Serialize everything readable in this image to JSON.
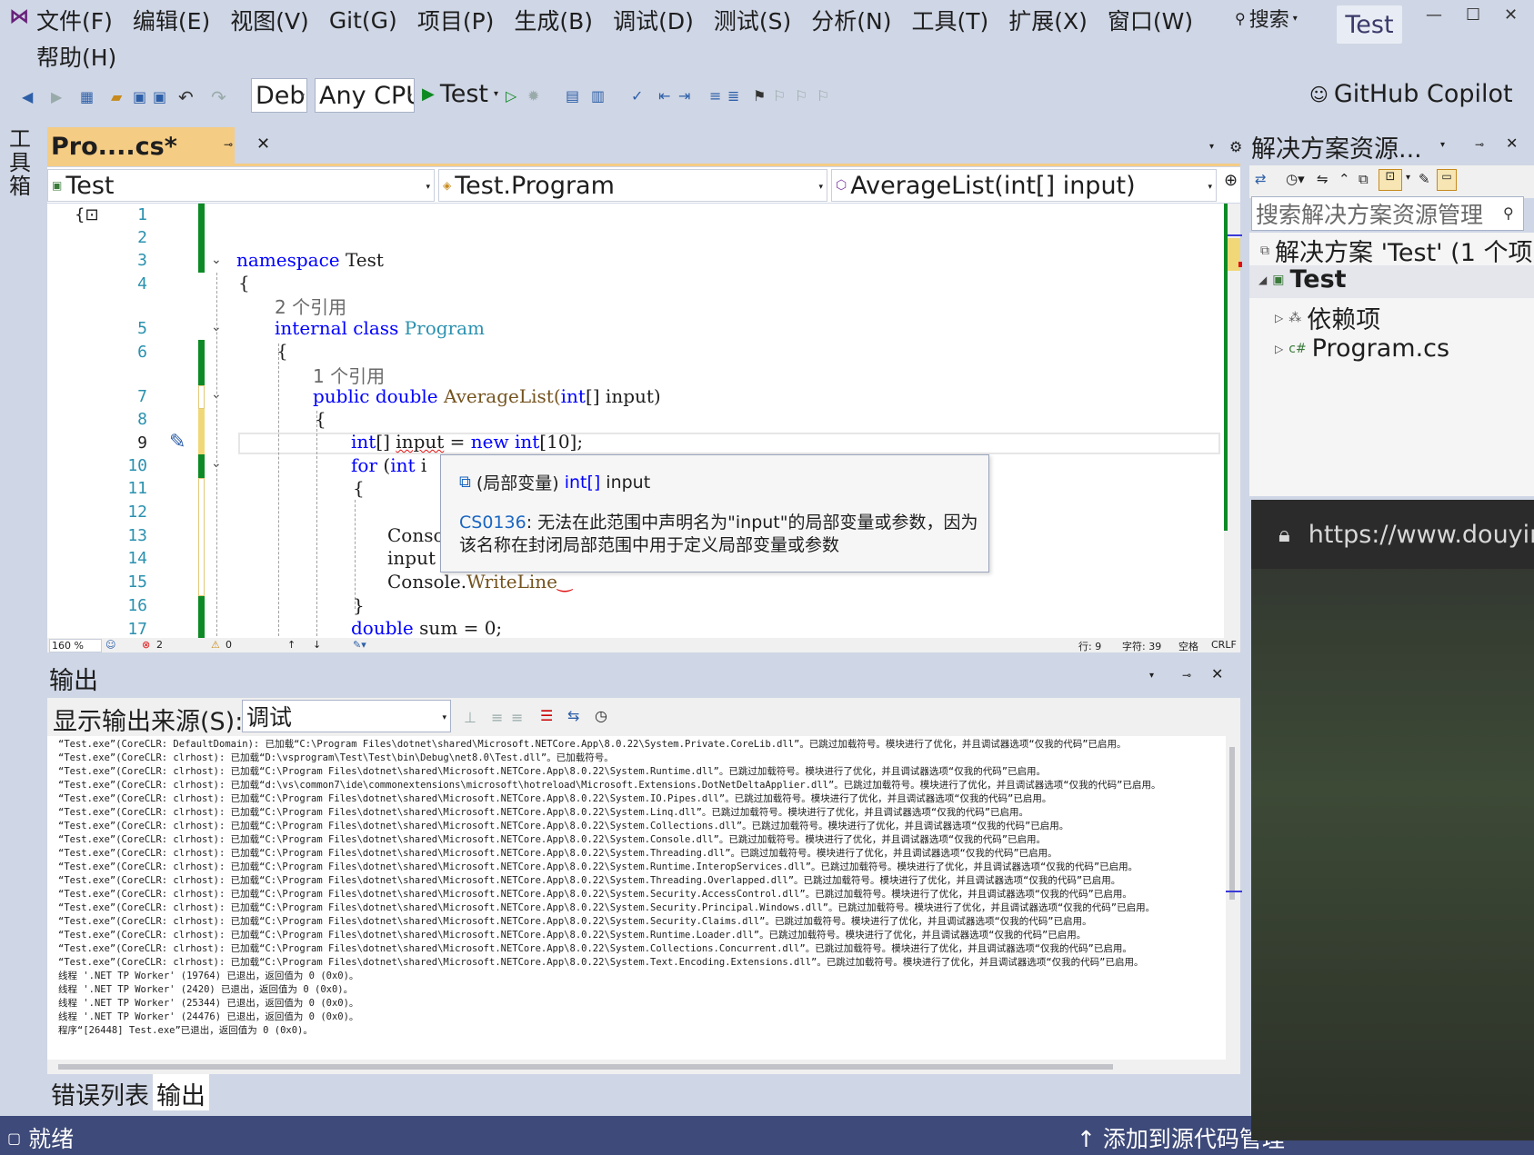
{
  "menu": {
    "row1": [
      "文件(F)",
      "编辑(E)",
      "视图(V)",
      "Git(G)",
      "项目(P)",
      "生成(B)",
      "调试(D)",
      "测试(S)",
      "分析(N)",
      "工具(T)",
      "扩展(X)",
      "窗口(W)"
    ],
    "row2": [
      "帮助(H)"
    ]
  },
  "search_label": "搜索",
  "window_title": "Test",
  "toolbar": {
    "config": "Debug",
    "platform": "Any CPU",
    "run_label": "Test",
    "copilot_label": "GitHub Copilot"
  },
  "toolbox_label": "工具箱",
  "doc_tab": {
    "title": "Pro....cs*"
  },
  "navbar": {
    "project": "Test",
    "type": "Test.Program",
    "member": "AverageList(int[] input)"
  },
  "editor": {
    "line_numbers": [
      "1",
      "2",
      "3",
      "4",
      "5",
      "6",
      "7",
      "8",
      "9",
      "10",
      "11",
      "12",
      "13",
      "14",
      "15",
      "16",
      "17"
    ],
    "code": {
      "l3_kw": "namespace",
      "l3_name": " Test",
      "l4": "{",
      "ref1": "2 个引用",
      "l5_kw1": "internal",
      "l5_kw2": " class",
      "l5_name": " Program",
      "l6": "{",
      "ref2": "1 个引用",
      "l7_kw1": "public",
      "l7_kw2": " double",
      "l7_name": " AverageList(",
      "l7_ty": "int",
      "l7_rest": "[] input)",
      "l8": "{",
      "l9_ty": "int",
      "l9_a": "[] ",
      "l9_var": "input",
      "l9_b": " = ",
      "l9_kw": "new",
      "l9_ty2": " int",
      "l9_c": "[10];",
      "l10_kw": "for",
      "l10_a": " (",
      "l10_ty": "int",
      "l10_b": " i",
      "l11": "{",
      "l13": "Consol",
      "l14": "input",
      "l15_a": "Console.",
      "l15_b": "WriteLine",
      "l16": "}",
      "l17_kw": "double",
      "l17_rest": " sum = 0;"
    }
  },
  "tooltip": {
    "prefix": "(局部变量)",
    "type": "int[]",
    "name": "input",
    "code": "CS0136",
    "message": ": 无法在此范围中声明名为\"input\"的局部变量或参数，因为该名称在封闭局部范围中用于定义局部变量或参数"
  },
  "editor_status": {
    "zoom": "160 %",
    "errors": "2",
    "warnings": "0",
    "line": "行: 9",
    "char": "字符: 39",
    "spaces": "空格",
    "eol": "CRLF"
  },
  "output": {
    "title": "输出",
    "source_label": "显示输出来源(S):",
    "source_value": "调试",
    "lines": [
      "“Test.exe”(CoreCLR: DefaultDomain): 已加载“C:\\Program Files\\dotnet\\shared\\Microsoft.NETCore.App\\8.0.22\\System.Private.CoreLib.dll”。已跳过加载符号。模块进行了优化，并且调试器选项“仅我的代码”已启用。",
      "“Test.exe”(CoreCLR: clrhost): 已加载“D:\\vsprogram\\Test\\Test\\bin\\Debug\\net8.0\\Test.dll”。已加载符号。",
      "“Test.exe”(CoreCLR: clrhost): 已加载“C:\\Program Files\\dotnet\\shared\\Microsoft.NETCore.App\\8.0.22\\System.Runtime.dll”。已跳过加载符号。模块进行了优化，并且调试器选项“仅我的代码”已启用。",
      "“Test.exe”(CoreCLR: clrhost): 已加载“d:\\vs\\common7\\ide\\commonextensions\\microsoft\\hotreload\\Microsoft.Extensions.DotNetDeltaApplier.dll”。已跳过加载符号。模块进行了优化，并且调试器选项“仅我的代码”已启用。",
      "“Test.exe”(CoreCLR: clrhost): 已加载“C:\\Program Files\\dotnet\\shared\\Microsoft.NETCore.App\\8.0.22\\System.IO.Pipes.dll”。已跳过加载符号。模块进行了优化，并且调试器选项“仅我的代码”已启用。",
      "“Test.exe”(CoreCLR: clrhost): 已加载“C:\\Program Files\\dotnet\\shared\\Microsoft.NETCore.App\\8.0.22\\System.Linq.dll”。已跳过加载符号。模块进行了优化，并且调试器选项“仅我的代码”已启用。",
      "“Test.exe”(CoreCLR: clrhost): 已加载“C:\\Program Files\\dotnet\\shared\\Microsoft.NETCore.App\\8.0.22\\System.Collections.dll”。已跳过加载符号。模块进行了优化，并且调试器选项“仅我的代码”已启用。",
      "“Test.exe”(CoreCLR: clrhost): 已加载“C:\\Program Files\\dotnet\\shared\\Microsoft.NETCore.App\\8.0.22\\System.Console.dll”。已跳过加载符号。模块进行了优化，并且调试器选项“仅我的代码”已启用。",
      "“Test.exe”(CoreCLR: clrhost): 已加载“C:\\Program Files\\dotnet\\shared\\Microsoft.NETCore.App\\8.0.22\\System.Threading.dll”。已跳过加载符号。模块进行了优化，并且调试器选项“仅我的代码”已启用。",
      "“Test.exe”(CoreCLR: clrhost): 已加载“C:\\Program Files\\dotnet\\shared\\Microsoft.NETCore.App\\8.0.22\\System.Runtime.InteropServices.dll”。已跳过加载符号。模块进行了优化，并且调试器选项“仅我的代码”已启用。",
      "“Test.exe”(CoreCLR: clrhost): 已加载“C:\\Program Files\\dotnet\\shared\\Microsoft.NETCore.App\\8.0.22\\System.Threading.Overlapped.dll”。已跳过加载符号。模块进行了优化，并且调试器选项“仅我的代码”已启用。",
      "“Test.exe”(CoreCLR: clrhost): 已加载“C:\\Program Files\\dotnet\\shared\\Microsoft.NETCore.App\\8.0.22\\System.Security.AccessControl.dll”。已跳过加载符号。模块进行了优化，并且调试器选项“仅我的代码”已启用。",
      "“Test.exe”(CoreCLR: clrhost): 已加载“C:\\Program Files\\dotnet\\shared\\Microsoft.NETCore.App\\8.0.22\\System.Security.Principal.Windows.dll”。已跳过加载符号。模块进行了优化，并且调试器选项“仅我的代码”已启用。",
      "“Test.exe”(CoreCLR: clrhost): 已加载“C:\\Program Files\\dotnet\\shared\\Microsoft.NETCore.App\\8.0.22\\System.Security.Claims.dll”。已跳过加载符号。模块进行了优化，并且调试器选项“仅我的代码”已启用。",
      "“Test.exe”(CoreCLR: clrhost): 已加载“C:\\Program Files\\dotnet\\shared\\Microsoft.NETCore.App\\8.0.22\\System.Runtime.Loader.dll”。已跳过加载符号。模块进行了优化，并且调试器选项“仅我的代码”已启用。",
      "“Test.exe”(CoreCLR: clrhost): 已加载“C:\\Program Files\\dotnet\\shared\\Microsoft.NETCore.App\\8.0.22\\System.Collections.Concurrent.dll”。已跳过加载符号。模块进行了优化，并且调试器选项“仅我的代码”已启用。",
      "“Test.exe”(CoreCLR: clrhost): 已加载“C:\\Program Files\\dotnet\\shared\\Microsoft.NETCore.App\\8.0.22\\System.Text.Encoding.Extensions.dll”。已跳过加载符号。模块进行了优化，并且调试器选项“仅我的代码”已启用。",
      "线程 '.NET TP Worker' (19764) 已退出，返回值为 0 (0x0)。",
      "线程 '.NET TP Worker' (2420) 已退出，返回值为 0 (0x0)。",
      "线程 '.NET TP Worker' (25344) 已退出，返回值为 0 (0x0)。",
      "线程 '.NET TP Worker' (24476) 已退出，返回值为 0 (0x0)。",
      "程序“[26448] Test.exe”已退出，返回值为 0 (0x0)。"
    ]
  },
  "bottom_tabs": [
    "错误列表",
    "输出"
  ],
  "statusbar": {
    "ready": "就绪",
    "add_source": "↑ 添加到源代码管理"
  },
  "solution_explorer": {
    "title": "解决方案资源...",
    "search_placeholder": "搜索解决方案资源管理",
    "solution_node": "解决方案 'Test' (1 个项",
    "project_node": "Test",
    "deps_node": "依赖项",
    "file_node": "Program.cs"
  },
  "browser": {
    "url": "https://www.douyin"
  },
  "colors": {
    "accent_tab": "#f5cc84",
    "status_bar": "#3e4a79",
    "chrome": "#cfd6e5",
    "keyword": "#0000ff",
    "type": "#2b91af"
  }
}
